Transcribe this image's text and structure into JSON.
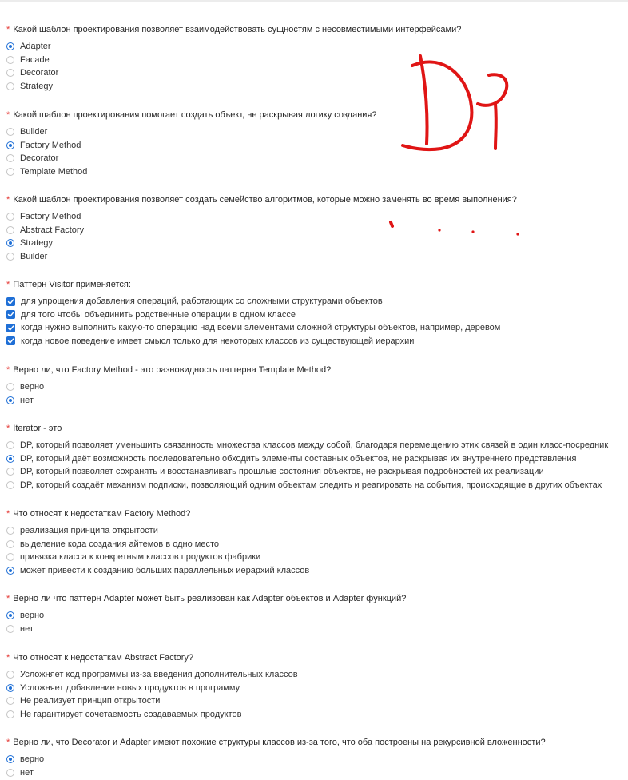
{
  "colors": {
    "accent": "#1f6fd6",
    "required": "#e53935",
    "ink": "#e01515"
  },
  "handwriting": {
    "text": "DP"
  },
  "questions": [
    {
      "title": "Какой шаблон проектирования позволяет взаимодействовать сущностям с несовместимыми интерфейсами?",
      "type": "radio",
      "options": [
        {
          "label": "Adapter",
          "checked": true
        },
        {
          "label": "Facade",
          "checked": false
        },
        {
          "label": "Decorator",
          "checked": false
        },
        {
          "label": "Strategy",
          "checked": false
        }
      ]
    },
    {
      "title": "Какой шаблон проектирования помогает создать объект, не раскрывая логику создания?",
      "type": "radio",
      "options": [
        {
          "label": "Builder",
          "checked": false
        },
        {
          "label": "Factory Method",
          "checked": true
        },
        {
          "label": "Decorator",
          "checked": false
        },
        {
          "label": "Template Method",
          "checked": false
        }
      ]
    },
    {
      "title": "Какой шаблон проектирования позволяет создать семейство алгоритмов, которые можно заменять во время выполнения?",
      "type": "radio",
      "options": [
        {
          "label": "Factory Method",
          "checked": false
        },
        {
          "label": "Abstract Factory",
          "checked": false
        },
        {
          "label": "Strategy",
          "checked": true
        },
        {
          "label": "Builder",
          "checked": false
        }
      ]
    },
    {
      "title": "Паттерн Visitor применяется:",
      "type": "checkbox",
      "options": [
        {
          "label": "для упрощения добавления операций, работающих со сложными структурами объектов",
          "checked": true
        },
        {
          "label": "для того чтобы объединить родственные операции в одном классе",
          "checked": true
        },
        {
          "label": "когда нужно выполнить какую-то операцию над всеми элементами сложной структуры объектов, например, деревом",
          "checked": true
        },
        {
          "label": "когда новое поведение имеет смысл только для некоторых классов из существующей иерархии",
          "checked": true
        }
      ]
    },
    {
      "title": "Верно ли, что Factory Method - это разновидность паттерна Template Method?",
      "type": "radio",
      "options": [
        {
          "label": "верно",
          "checked": false
        },
        {
          "label": "нет",
          "checked": true
        }
      ]
    },
    {
      "title": "Iterator - это",
      "type": "radio",
      "options": [
        {
          "label": "DP, который позволяет уменьшить связанность множества классов между собой, благодаря перемещению этих связей в один класс-посредник",
          "checked": false
        },
        {
          "label": "DP, который даёт возможность последовательно обходить элементы составных объектов, не раскрывая их внутреннего представления",
          "checked": true
        },
        {
          "label": "DP, который позволяет сохранять и восстанавливать прошлые состояния объектов, не раскрывая подробностей их реализации",
          "checked": false
        },
        {
          "label": "DP, который создаёт механизм подписки, позволяющий одним объектам следить и реагировать на события, происходящие в других объектах",
          "checked": false
        }
      ]
    },
    {
      "title": "Что относят к недостаткам Factory Method?",
      "type": "radio",
      "options": [
        {
          "label": "реализация принципа открытости",
          "checked": false
        },
        {
          "label": "выделение кода создания айтемов в одно место",
          "checked": false
        },
        {
          "label": "привязка класса к конкретным классов продуктов фабрики",
          "checked": false
        },
        {
          "label": "может привести к созданию больших параллельных иерархий классов",
          "checked": true
        }
      ]
    },
    {
      "title": "Верно ли что паттерн Adapter может быть реализован как Adapter объектов и Adapter функций?",
      "type": "radio",
      "options": [
        {
          "label": "верно",
          "checked": true
        },
        {
          "label": "нет",
          "checked": false
        }
      ]
    },
    {
      "title": "Что относят к недостаткам Abstract Factory?",
      "type": "radio",
      "options": [
        {
          "label": "Усложняет код программы из-за введения дополнительных классов",
          "checked": false
        },
        {
          "label": "Усложняет добавление новых продуктов в программу",
          "checked": true
        },
        {
          "label": "Не реализует принцип открытости",
          "checked": false
        },
        {
          "label": "Не гарантирует сочетаемость создаваемых продуктов",
          "checked": false
        }
      ]
    },
    {
      "title": "Верно ли, что Decorator и Adapter имеют похожие структуры классов из-за того, что оба построены на рекурсивной вложенности?",
      "type": "radio",
      "options": [
        {
          "label": "верно",
          "checked": true
        },
        {
          "label": "нет",
          "checked": false
        }
      ]
    }
  ]
}
